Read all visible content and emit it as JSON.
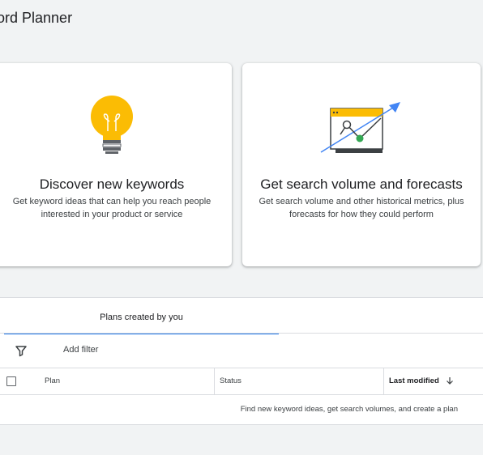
{
  "page": {
    "title": "ord Planner"
  },
  "cards": {
    "discover": {
      "title": "Discover new keywords",
      "description": "Get keyword ideas that can help you reach people interested in your product or service",
      "icon": "lightbulb-icon",
      "colors": {
        "bulb": "#fbbc04",
        "base": "#5f6368"
      }
    },
    "forecast": {
      "title": "Get search volume and forecasts",
      "description": "Get search volume and other historical metrics, plus forecasts for how they could perform",
      "icon": "trend-chart-icon",
      "colors": {
        "header": "#fbbc04",
        "arrow": "#4285f4",
        "point": "#34a853"
      }
    }
  },
  "plans": {
    "tab_label": "Plans created by you",
    "add_filter_label": "Add filter",
    "columns": {
      "plan": "Plan",
      "status": "Status",
      "last_modified": "Last modified"
    },
    "sort_icon": "arrow-down-icon",
    "empty_message": "Find new keyword ideas, get search volumes, and create a plan"
  },
  "colors": {
    "accent": "#1a73e8",
    "background": "#f1f3f4"
  }
}
